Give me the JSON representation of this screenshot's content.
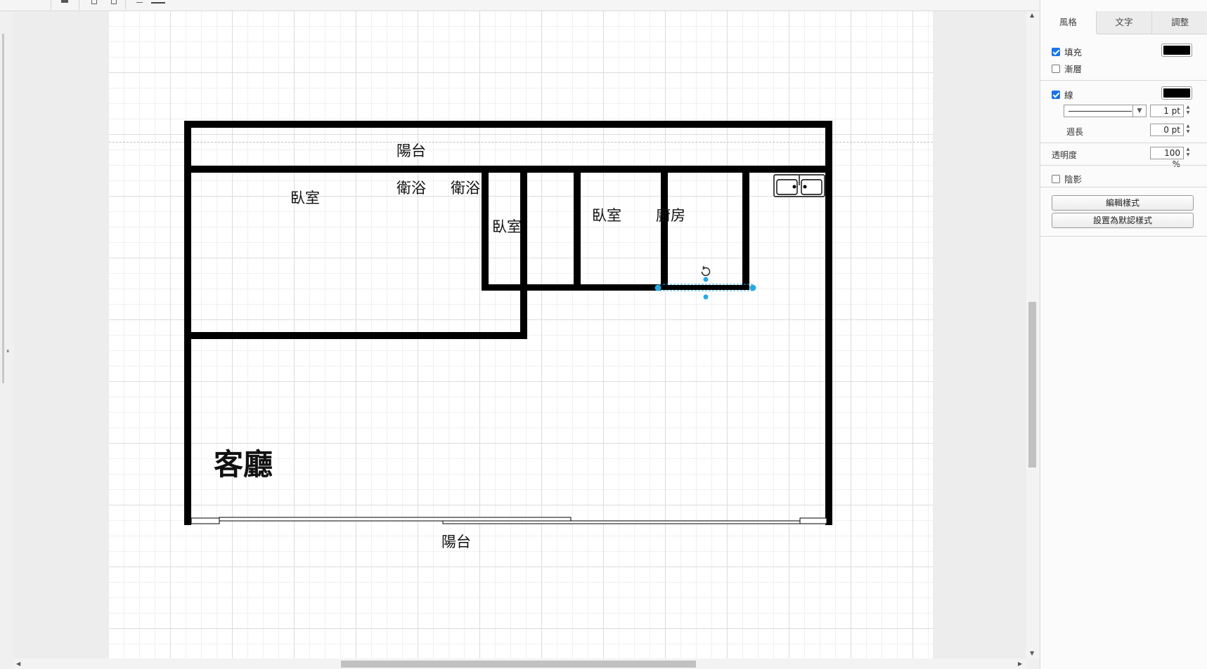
{
  "toolbar": {
    "icons": [
      "format-icon",
      "page-icon",
      "page-icon",
      "waypoint-icon",
      "line-style-icon"
    ]
  },
  "floorplan": {
    "rooms": {
      "balcony_top": "陽台",
      "bedroom_1": "臥室",
      "bathroom_1": "衛浴",
      "bathroom_2": "衛浴",
      "bedroom_2": "臥室",
      "bedroom_3": "臥室",
      "kitchen": "廚房",
      "living_room": "客廳",
      "balcony_bottom": "陽台"
    },
    "fixture": "sink-icon"
  },
  "panel": {
    "tabs": [
      "風格",
      "文字",
      "調整"
    ],
    "active_tab": "風格",
    "fill": {
      "label": "填充",
      "checked": true,
      "color": "#000000"
    },
    "gradient": {
      "label": "漸層",
      "checked": false
    },
    "line": {
      "label": "線",
      "checked": true,
      "color": "#000000",
      "width": "1 pt"
    },
    "perimeter": {
      "label": "週長",
      "value": "0 pt"
    },
    "opacity": {
      "label": "透明度",
      "value": "100 %"
    },
    "shadow": {
      "label": "陰影",
      "checked": false
    },
    "edit_style_button": "編輯樣式",
    "set_default_button": "設置為默認樣式"
  },
  "colors": {
    "selection_handle": "#29a9e0",
    "wall": "#000000",
    "checkbox_accent": "#1a73e8"
  }
}
